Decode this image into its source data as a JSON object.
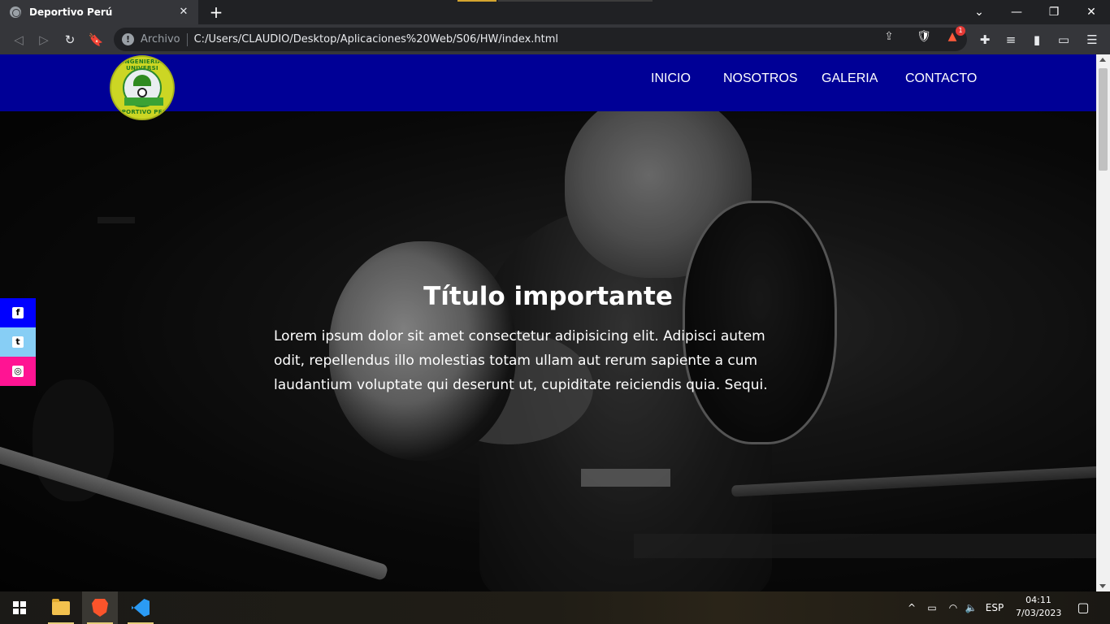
{
  "browser": {
    "tab_title": "Deportivo Perú",
    "tab_close": "✕",
    "new_tab": "+",
    "window_controls": {
      "minimize": "—",
      "restore": "❐",
      "close": "✕",
      "tab_menu": "⌄"
    },
    "security_label": "Archivo",
    "url": "C:/Users/CLAUDIO/Desktop/Aplicaciones%20Web/S06/HW/index.html",
    "rewards_badge": "1"
  },
  "site": {
    "logo_ring_top": "INGENIERIA UNIVERSI",
    "logo_ring_bottom": "DEPORTIVO PERÚ",
    "nav": [
      "INICIO",
      "NOSOTROS",
      "GALERIA",
      "CONTACTO"
    ],
    "hero": {
      "title": "Título importante",
      "text": "Lorem ipsum dolor sit amet consectetur adipisicing elit. Adipisci autem odit, repellendus illo molestias totam ullam aut rerum sapiente a cum laudantium voluptate qui deserunt ut, cupiditate reiciendis quia. Sequi."
    },
    "social": [
      {
        "name": "facebook",
        "icon": "facebook-icon",
        "color": "#0000ff",
        "glyph": "f"
      },
      {
        "name": "twitter",
        "icon": "twitter-icon",
        "color": "#87cef5",
        "glyph": "t"
      },
      {
        "name": "instagram",
        "icon": "instagram-icon",
        "color": "#ff1493",
        "glyph": "◎"
      }
    ],
    "header_color": "#000096"
  },
  "taskbar": {
    "language": "ESP",
    "time": "04:11",
    "date": "7/03/2023"
  }
}
